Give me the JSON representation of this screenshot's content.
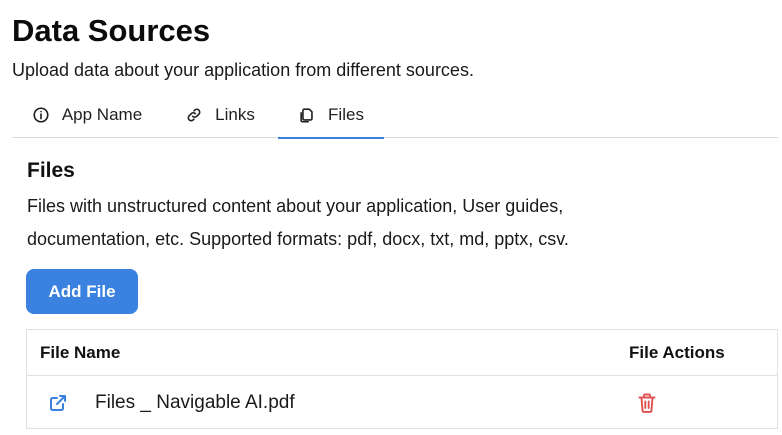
{
  "header": {
    "title": "Data Sources",
    "subtitle": "Upload data about your application from different sources."
  },
  "tabs": [
    {
      "label": "App Name",
      "icon": "info-icon",
      "active": false
    },
    {
      "label": "Links",
      "icon": "link-icon",
      "active": false
    },
    {
      "label": "Files",
      "icon": "files-icon",
      "active": true
    }
  ],
  "files_section": {
    "title": "Files",
    "description": "Files with unstructured content about your application, User guides, documentation, etc. Supported formats: pdf, docx, txt, md, pptx, csv.",
    "add_button_label": "Add File"
  },
  "table": {
    "columns": [
      "File Name",
      "File Actions"
    ],
    "rows": [
      {
        "file_name": "Files _ Navigable AI.pdf"
      }
    ]
  },
  "colors": {
    "accent": "#3b82e0",
    "danger": "#e05252"
  }
}
